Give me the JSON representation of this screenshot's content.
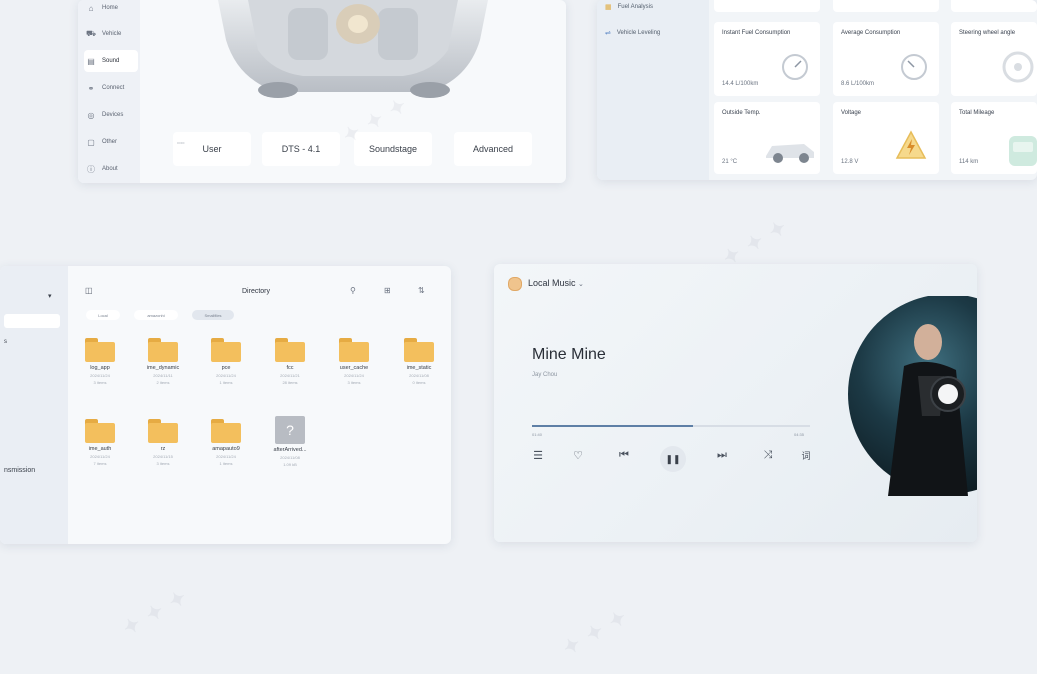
{
  "sound_panel": {
    "nav_items": [
      {
        "icon": "home-icon",
        "glyph": "⌂",
        "label": "Home"
      },
      {
        "icon": "car-icon",
        "glyph": "⛟",
        "label": "Vehicle"
      },
      {
        "icon": "speaker-icon",
        "glyph": "▤",
        "label": "Sound",
        "active": true
      },
      {
        "icon": "connect-icon",
        "glyph": "⚭",
        "label": "Connect"
      },
      {
        "icon": "devices-icon",
        "glyph": "◎",
        "label": "Devices"
      },
      {
        "icon": "other-icon",
        "glyph": "▢",
        "label": "Other"
      },
      {
        "icon": "about-icon",
        "glyph": "ⓘ",
        "label": "About"
      }
    ],
    "tabs": [
      "User",
      "DTS - 4.1",
      "Soundstage",
      "Advanced"
    ]
  },
  "vehicle_panel": {
    "nav_items": [
      {
        "icon": "fuel-analysis-icon",
        "label": "Fuel Analysis"
      },
      {
        "icon": "vehicle-leveling-icon",
        "label": "Vehicle Leveling"
      }
    ],
    "tiles": [
      {
        "title": "Instant Fuel Consumption",
        "value": "14.4 L/100km"
      },
      {
        "title": "Average Consumption",
        "value": "8.6 L/100km"
      },
      {
        "title": "Steering wheel angle",
        "value": ""
      },
      {
        "title": "Outside Temp.",
        "value": "21 °C"
      },
      {
        "title": "Voltage",
        "value": "12.8 V"
      },
      {
        "title": "Total Mileage",
        "value": "114 km"
      }
    ]
  },
  "files_panel": {
    "side_label": "nsmission",
    "title": "Directory",
    "path": [
      "Local",
      "amazonhi",
      "Smallfiles"
    ],
    "folders": [
      {
        "name": "log_app",
        "date": "2024/11/24",
        "count": "3 items"
      },
      {
        "name": "ime_dynamic",
        "date": "2024/11/11",
        "count": "2 items"
      },
      {
        "name": "pce",
        "date": "2024/11/24",
        "count": "1 items"
      },
      {
        "name": "fcc",
        "date": "2024/11/21",
        "count": "28 items"
      },
      {
        "name": "user_cache",
        "date": "2024/11/24",
        "count": "3 items"
      },
      {
        "name": "ime_static",
        "date": "2024/11/08",
        "count": "0 items"
      },
      {
        "name": "ime_auth",
        "date": "2024/11/24",
        "count": "7 items"
      },
      {
        "name": "rz",
        "date": "2024/11/15",
        "count": "3 items"
      },
      {
        "name": "amapauto9",
        "date": "2024/11/24",
        "count": "1 items"
      },
      {
        "name": "afterArrived...",
        "date": "2024/11/08",
        "count": "1.09 kB",
        "unknown": true
      }
    ]
  },
  "music_panel": {
    "source_label": "Local Music",
    "song_title": "Mine Mine",
    "artist": "Jay Chou",
    "time_current": "01:40",
    "time_total": "04:35",
    "progress": 0.58,
    "controls": [
      {
        "icon": "playlist-icon",
        "glyph": "☰"
      },
      {
        "icon": "heart-icon",
        "glyph": "♡"
      },
      {
        "icon": "previous-icon",
        "glyph": "⏮"
      },
      {
        "icon": "pause-icon",
        "glyph": "❚❚"
      },
      {
        "icon": "next-icon",
        "glyph": "⏭"
      },
      {
        "icon": "shuffle-icon",
        "glyph": "⤨"
      },
      {
        "icon": "lyrics-icon",
        "glyph": "词"
      }
    ]
  },
  "colors": {
    "folder": "#f3bf5d",
    "accent": "#5e7fa6",
    "background": "#eef1f5"
  }
}
